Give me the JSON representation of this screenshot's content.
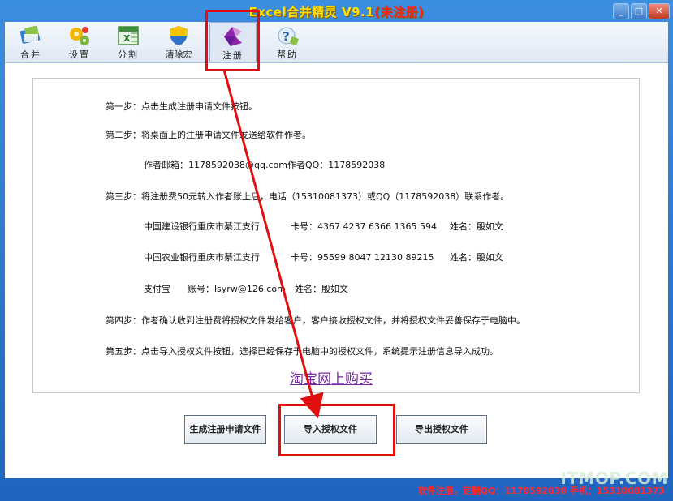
{
  "window": {
    "title_main": "Excel合并精灵 V9.1",
    "title_status": "(未注册)",
    "min_label": "_",
    "max_label": "□",
    "close_label": "✕"
  },
  "toolbar": {
    "items": [
      {
        "label": "合并",
        "icon": "merge-icon"
      },
      {
        "label": "设置",
        "icon": "gear-icon"
      },
      {
        "label": "分割",
        "icon": "split-sheet-icon"
      },
      {
        "label": "清除宏",
        "icon": "shield-icon"
      },
      {
        "label": "注册",
        "icon": "register-icon"
      },
      {
        "label": "帮助",
        "icon": "help-icon"
      }
    ],
    "active": "注册"
  },
  "instructions": {
    "step1": "第一步：点击生成注册申请文件按钮。",
    "step2": "第二步：将桌面上的注册申请文件发送给软件作者。",
    "contact": "作者邮箱：1178592038@qq.com作者QQ：1178592038",
    "step3": "第三步：将注册费50元转入作者账上后，电话（15310081373）或QQ（1178592038）联系作者。",
    "bank1_name": "中国建设银行重庆市綦江支行",
    "bank1_card": "卡号：4367 4237 6366 1365 594",
    "bank1_holder": "姓名：殷如文",
    "bank2_name": "中国农业银行重庆市綦江支行",
    "bank2_card": "卡号：95599 8047 12130 89215",
    "bank2_holder": "姓名：殷如文",
    "alipay_name": "支付宝",
    "alipay_account": "账号：lsyrw@126.com",
    "alipay_holder": "姓名：殷如文",
    "step4": "第四步：作者确认收到注册费将授权文件发给客户，客户接收授权文件，并将授权文件妥善保存于电脑中。",
    "step5": "第五步：点击导入授权文件按钮，选择已经保存于电脑中的授权文件，系统提示注册信息导入成功。",
    "taobao_link": "淘宝网上购买"
  },
  "buttons": {
    "generate": "生成注册申请文件",
    "import": "导入授权文件",
    "export": "导出授权文件"
  },
  "statusbar": {
    "text": "软件注册，定制QQ：1178592038 手机：15310081373"
  },
  "watermark": "ITMOP.COM",
  "colors": {
    "title_yellow": "#ffe000",
    "unregistered_red": "#ff2020",
    "annotation_red": "#e01010",
    "link_purple": "#7a2aa6"
  }
}
